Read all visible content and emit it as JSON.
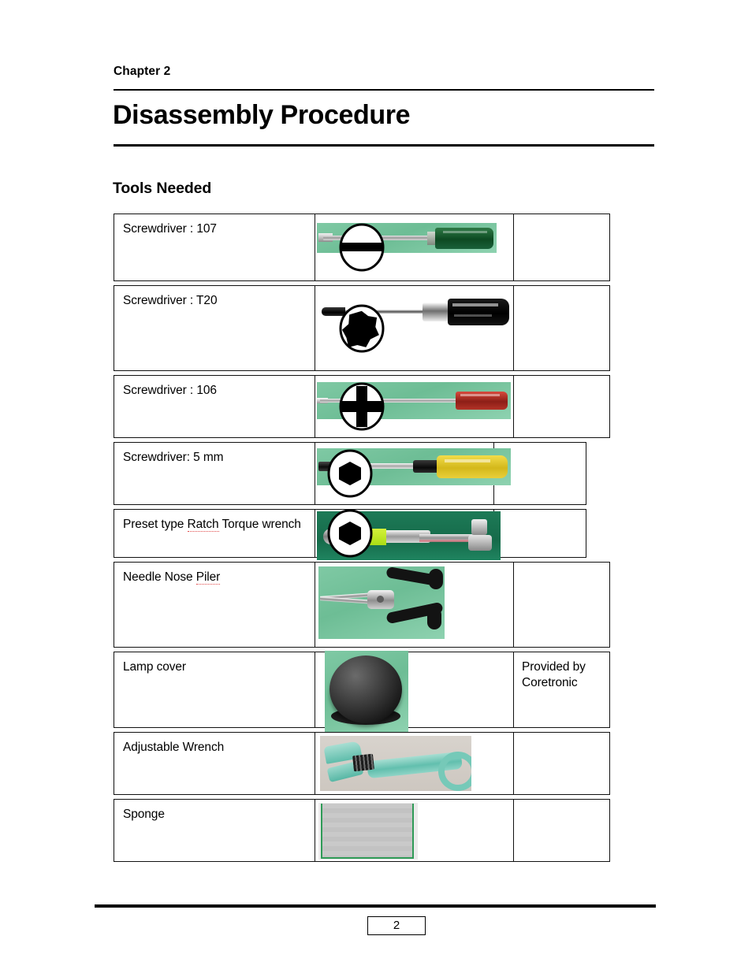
{
  "header": {
    "chapter_label": "Chapter 2",
    "title": "Disassembly Procedure"
  },
  "section": {
    "title": "Tools Needed"
  },
  "table": {
    "rows": [
      {
        "name": "Screwdriver : 107",
        "name_misspelled": "",
        "photo": "flat-head-screwdriver-green-handle-photo",
        "icon": "flat-slotted-screw-head-icon",
        "note": ""
      },
      {
        "name": "Screwdriver : T20",
        "name_misspelled": "",
        "photo": "torx-screwdriver-black-handle-photo",
        "icon": "torx-screw-head-icon",
        "note": ""
      },
      {
        "name": "Screwdriver : 106",
        "name_misspelled": "",
        "photo": "phillips-screwdriver-red-handle-photo",
        "icon": "phillips-screw-head-icon",
        "note": ""
      },
      {
        "name": "Screwdriver: 5 mm",
        "name_misspelled": "",
        "photo": "hex-screwdriver-yellow-handle-photo",
        "icon": "hex-screw-head-icon",
        "note": ""
      },
      {
        "name_part1": "Preset type ",
        "name_misspelled": "Ratch",
        "name_part2": " Torque wrench",
        "photo": "preset-ratchet-torque-wrench-photo",
        "icon": "hex-screw-head-icon",
        "note": ""
      },
      {
        "name_part1": "Needle Nose ",
        "name_misspelled": "Piler",
        "name_part2": "",
        "photo": "needle-nose-pliers-photo",
        "icon": "",
        "note": ""
      },
      {
        "name": "Lamp cover",
        "name_misspelled": "",
        "photo": "lamp-cover-dome-photo",
        "icon": "",
        "note": "Provided by Coretronic"
      },
      {
        "name": "Adjustable Wrench",
        "name_misspelled": "",
        "photo": "adjustable-wrench-photo",
        "icon": "",
        "note": ""
      },
      {
        "name": "Sponge",
        "name_misspelled": "",
        "photo": "sponge-block-photo",
        "icon": "",
        "note": ""
      }
    ]
  },
  "footer": {
    "page_number": "2"
  },
  "colors": {
    "ink": "#000000",
    "page": "#ffffff",
    "border": "#111111",
    "spell_error_underline": "#e04a4a",
    "photo_green_mat": "#6dbd95",
    "tool_teal": "#62bfae"
  }
}
